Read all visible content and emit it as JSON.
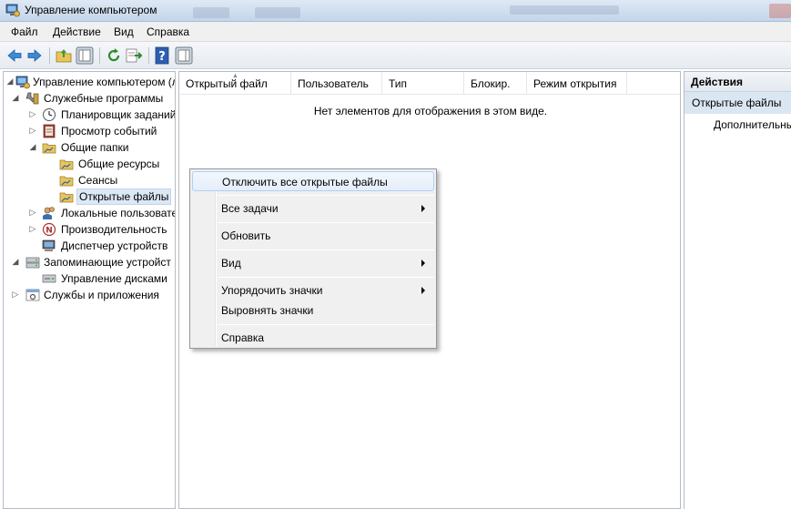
{
  "window": {
    "title": "Управление компьютером"
  },
  "menu": [
    "Файл",
    "Действие",
    "Вид",
    "Справка"
  ],
  "toolbar": {
    "buttons": [
      "back-icon",
      "forward-icon",
      "up-folder-icon",
      "show-hide-tree-icon",
      "refresh-icon",
      "export-list-icon",
      "help-icon",
      "show-hide-actions-icon"
    ]
  },
  "tree": {
    "items": [
      {
        "label": "Управление компьютером (л",
        "level": 0,
        "expanded": true
      },
      {
        "label": "Служебные программы",
        "level": 1,
        "expanded": true
      },
      {
        "label": "Планировщик заданий",
        "level": 2,
        "expanded": false
      },
      {
        "label": "Просмотр событий",
        "level": 2,
        "expanded": false
      },
      {
        "label": "Общие папки",
        "level": 2,
        "expanded": true
      },
      {
        "label": "Общие ресурсы",
        "level": 3
      },
      {
        "label": "Сеансы",
        "level": 3
      },
      {
        "label": "Открытые файлы",
        "level": 3,
        "selected": true
      },
      {
        "label": "Локальные пользовате",
        "level": 2,
        "expanded": false
      },
      {
        "label": "Производительность",
        "level": 2,
        "expanded": false
      },
      {
        "label": "Диспетчер устройств",
        "level": 2
      },
      {
        "label": "Запоминающие устройст",
        "level": 1,
        "expanded": true
      },
      {
        "label": "Управление дисками",
        "level": 2
      },
      {
        "label": "Службы и приложения",
        "level": 1,
        "expanded": false
      }
    ]
  },
  "content": {
    "columns": [
      "Открытый файл",
      "Пользователь",
      "Тип",
      "Блокир.",
      "Режим открытия"
    ],
    "empty_message": "Нет элементов для отображения в этом виде."
  },
  "actions": {
    "header": "Действия",
    "section": "Открытые файлы",
    "more": "Дополнительные действия"
  },
  "context_menu": {
    "items": [
      {
        "label": "Отключить все открытые файлы",
        "submenu": false,
        "highlighted": true
      },
      {
        "label": "Все задачи",
        "submenu": true
      },
      {
        "label": "Обновить",
        "submenu": false
      },
      {
        "label": "Вид",
        "submenu": true
      },
      {
        "label": "Упорядочить значки",
        "submenu": true
      },
      {
        "label": "Выровнять значки",
        "submenu": false
      },
      {
        "label": "Справка",
        "submenu": false
      }
    ]
  }
}
